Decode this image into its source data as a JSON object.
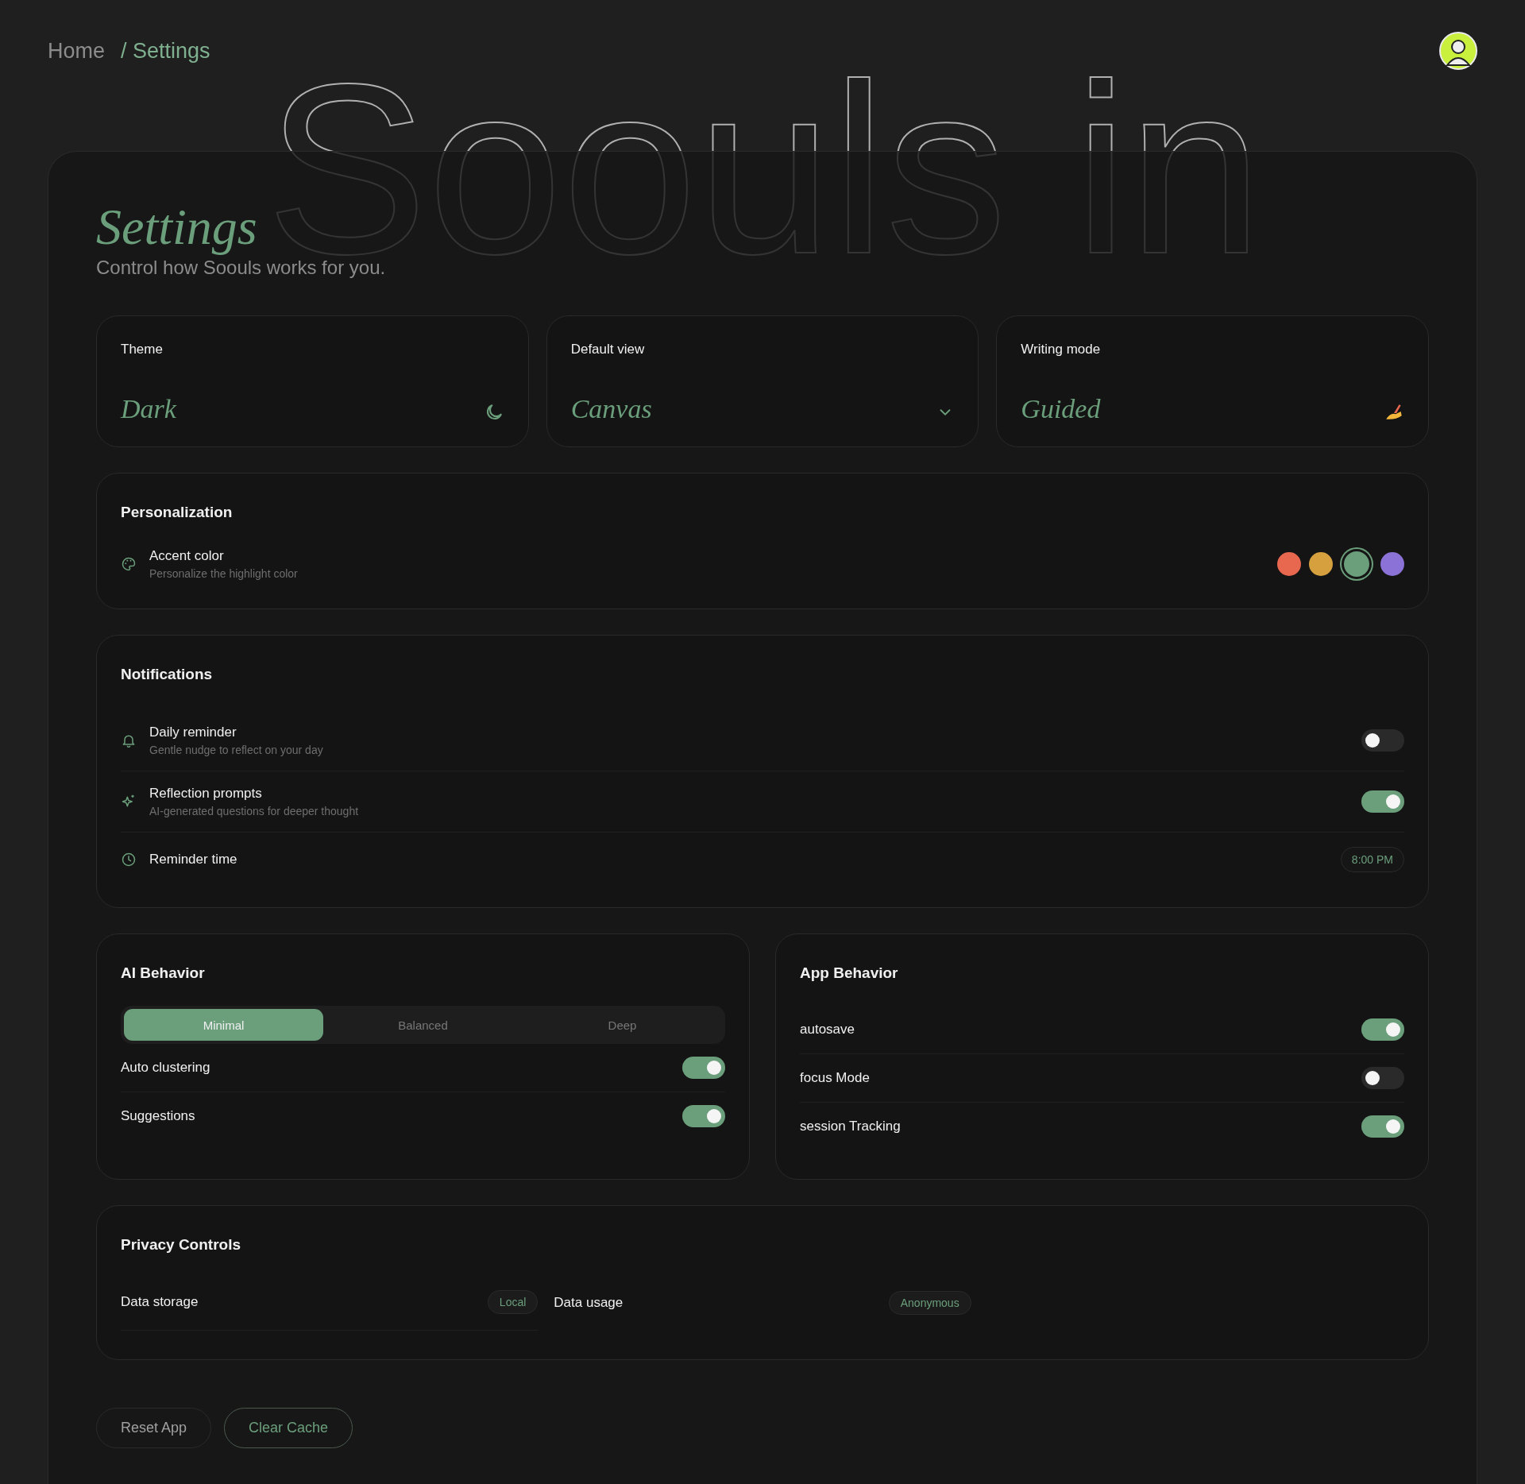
{
  "breadcrumb": [
    {
      "label": "Home",
      "current": false
    },
    {
      "label": "/ Settings",
      "current": true
    }
  ],
  "backdrop_text": "Soouls in",
  "title": "Settings",
  "subtitle": "Control how Soouls works for you.",
  "quick_settings": [
    {
      "label": "Theme",
      "value": "Dark",
      "kind": "moon"
    },
    {
      "label": "Default view",
      "value": "Canvas",
      "kind": "dropdown"
    },
    {
      "label": "Writing mode",
      "value": "Guided",
      "kind": "writing"
    }
  ],
  "personalization": {
    "title": "Personalization",
    "label": "Accent color",
    "description": "Personalize the highlight color",
    "swatches": [
      {
        "color": "#e8674f",
        "selected": false
      },
      {
        "color": "#d6a03f",
        "selected": false
      },
      {
        "color": "#6b9f7c",
        "selected": true
      },
      {
        "color": "#8b72d6",
        "selected": false
      }
    ]
  },
  "notifications": {
    "title": "Notifications",
    "rows": [
      {
        "kind": "toggle",
        "label": "Daily reminder",
        "description": "Gentle nudge to reflect on your day",
        "on": false
      },
      {
        "kind": "toggle",
        "label": "Reflection prompts",
        "description": "AI-generated questions for deeper thought",
        "on": true
      },
      {
        "kind": "time",
        "label": "Reminder time",
        "value": "8:00 PM"
      }
    ]
  },
  "ai_behavior": {
    "title": "AI Behavior",
    "segments": [
      {
        "label": "Minimal",
        "selected": true
      },
      {
        "label": "Balanced",
        "selected": false
      },
      {
        "label": "Deep",
        "selected": false
      }
    ],
    "toggles": [
      {
        "label": "Auto clustering",
        "on": true
      },
      {
        "label": "Suggestions",
        "on": true
      }
    ]
  },
  "app_behavior": {
    "title": "App Behavior",
    "toggles": [
      {
        "label": "autosave",
        "on": true
      },
      {
        "label": "focus Mode",
        "on": false
      },
      {
        "label": "session Tracking",
        "on": true
      }
    ]
  },
  "privacy": {
    "title": "Privacy Controls",
    "items": [
      {
        "label": "Data storage",
        "value": "Local"
      },
      {
        "label": "Data usage",
        "value": "Anonymous"
      }
    ]
  },
  "buttons": [
    {
      "label": "Reset App",
      "kind": "plain"
    },
    {
      "label": "Clear Cache",
      "kind": "accent"
    }
  ]
}
